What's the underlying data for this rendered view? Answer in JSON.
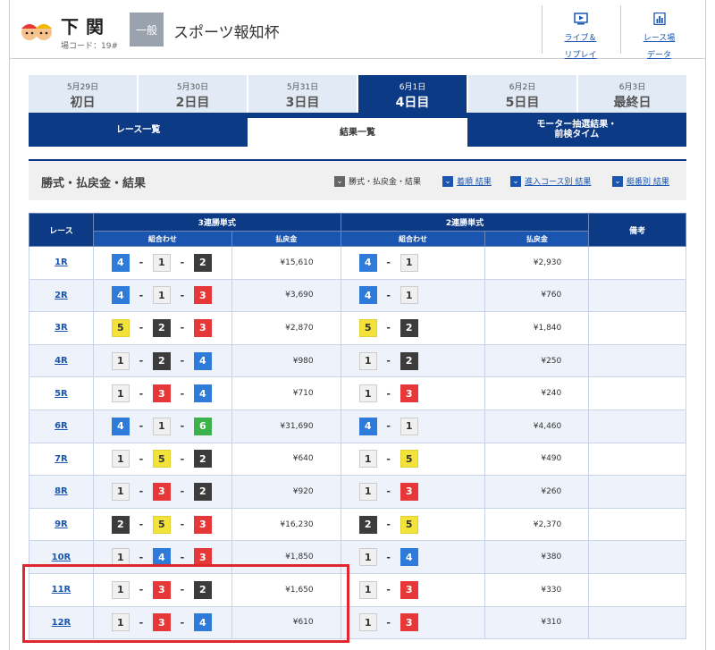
{
  "header": {
    "venue_name": "下関",
    "venue_code": "場コード：19#",
    "grade": "一般",
    "race_title": "スポーツ報知杯",
    "buttons": [
      {
        "label": "ライブ＆\nリプレイ",
        "icon": "video-icon"
      },
      {
        "label": "レース場\nデータ",
        "icon": "chart-icon"
      }
    ]
  },
  "days": [
    {
      "date": "5月29日",
      "name": "初日"
    },
    {
      "date": "5月30日",
      "name": "2日目"
    },
    {
      "date": "5月31日",
      "name": "3日目"
    },
    {
      "date": "6月1日",
      "name": "4日目",
      "active": true
    },
    {
      "date": "6月2日",
      "name": "5日目"
    },
    {
      "date": "6月3日",
      "name": "最終日"
    }
  ],
  "subtabs": [
    {
      "label": "レース一覧"
    },
    {
      "label": "結果一覧",
      "active": true
    },
    {
      "label": "モーター抽選結果・\n前検タイム"
    }
  ],
  "section": {
    "title": "勝式・払戻金・結果",
    "filters": [
      {
        "label": "勝式・払戻金・結果",
        "style": "gray",
        "link": false
      },
      {
        "label": "着順 結果",
        "style": "blue",
        "link": true
      },
      {
        "label": "進入コース別 結果",
        "style": "blue",
        "link": true
      },
      {
        "label": "艇番別 結果",
        "style": "blue",
        "link": true
      }
    ]
  },
  "table": {
    "headers": {
      "race": "レース",
      "trifecta": "3連勝単式",
      "exacta": "2連勝単式",
      "notes": "備考",
      "combo": "組合わせ",
      "payout": "払戻金"
    },
    "rows": [
      {
        "race": "1R",
        "tri": [
          4,
          1,
          2
        ],
        "tri_pay": "¥15,610",
        "ex": [
          4,
          1
        ],
        "ex_pay": "¥2,930"
      },
      {
        "race": "2R",
        "tri": [
          4,
          1,
          3
        ],
        "tri_pay": "¥3,690",
        "ex": [
          4,
          1
        ],
        "ex_pay": "¥760"
      },
      {
        "race": "3R",
        "tri": [
          5,
          2,
          3
        ],
        "tri_pay": "¥2,870",
        "ex": [
          5,
          2
        ],
        "ex_pay": "¥1,840"
      },
      {
        "race": "4R",
        "tri": [
          1,
          2,
          4
        ],
        "tri_pay": "¥980",
        "ex": [
          1,
          2
        ],
        "ex_pay": "¥250"
      },
      {
        "race": "5R",
        "tri": [
          1,
          3,
          4
        ],
        "tri_pay": "¥710",
        "ex": [
          1,
          3
        ],
        "ex_pay": "¥240"
      },
      {
        "race": "6R",
        "tri": [
          4,
          1,
          6
        ],
        "tri_pay": "¥31,690",
        "ex": [
          4,
          1
        ],
        "ex_pay": "¥4,460"
      },
      {
        "race": "7R",
        "tri": [
          1,
          5,
          2
        ],
        "tri_pay": "¥640",
        "ex": [
          1,
          5
        ],
        "ex_pay": "¥490"
      },
      {
        "race": "8R",
        "tri": [
          1,
          3,
          2
        ],
        "tri_pay": "¥920",
        "ex": [
          1,
          3
        ],
        "ex_pay": "¥260"
      },
      {
        "race": "9R",
        "tri": [
          2,
          5,
          3
        ],
        "tri_pay": "¥16,230",
        "ex": [
          2,
          5
        ],
        "ex_pay": "¥2,370"
      },
      {
        "race": "10R",
        "tri": [
          1,
          4,
          3
        ],
        "tri_pay": "¥1,850",
        "ex": [
          1,
          4
        ],
        "ex_pay": "¥380"
      },
      {
        "race": "11R",
        "tri": [
          1,
          3,
          2
        ],
        "tri_pay": "¥1,650",
        "ex": [
          1,
          3
        ],
        "ex_pay": "¥330"
      },
      {
        "race": "12R",
        "tri": [
          1,
          3,
          4
        ],
        "tri_pay": "¥610",
        "ex": [
          1,
          3
        ],
        "ex_pay": "¥310"
      }
    ]
  },
  "colors": {
    "navy": "#0d3a85",
    "boat1": "#f0f0f0",
    "boat2": "#3c3c3c",
    "boat3": "#e63838",
    "boat4": "#2f7bd9",
    "boat5": "#f2e23a",
    "boat6": "#3bb34a",
    "highlight": "#e0262e"
  }
}
